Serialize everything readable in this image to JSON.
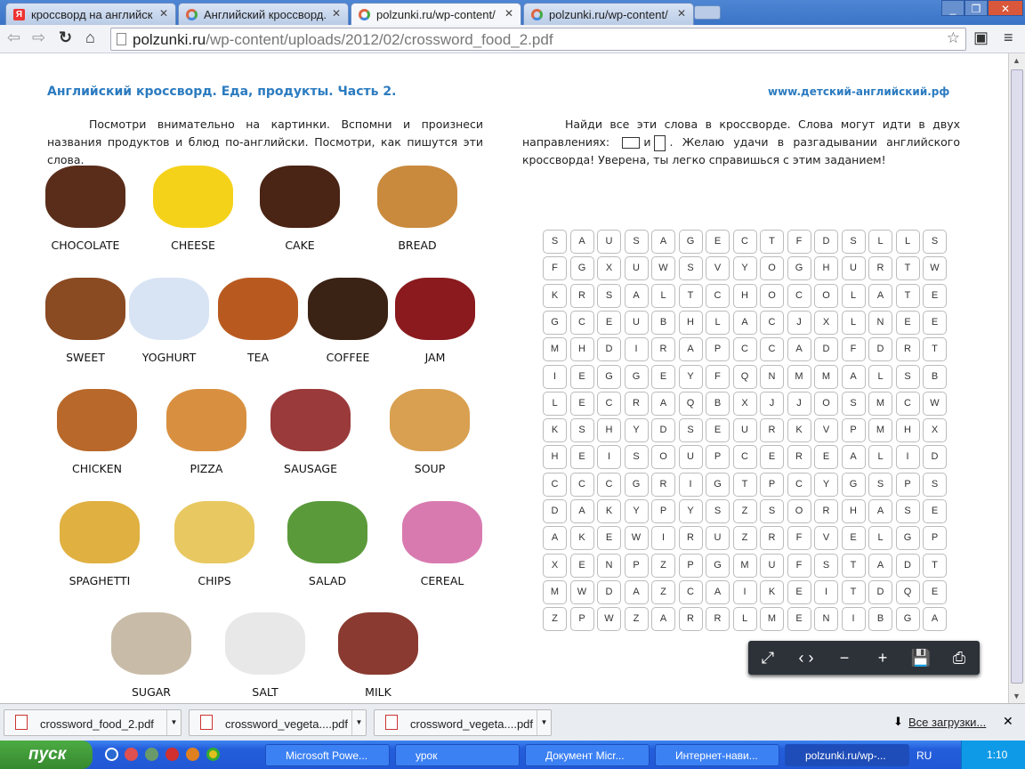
{
  "browser": {
    "tabs": [
      {
        "label": "кроссворд на английск",
        "icon": "yandex-icon"
      },
      {
        "label": "Английский кроссворд.",
        "icon": "site-icon"
      },
      {
        "label": "polzunki.ru/wp-content/",
        "icon": "site-icon",
        "active": true
      },
      {
        "label": "polzunki.ru/wp-content/",
        "icon": "site-icon"
      }
    ],
    "url_host": "polzunki.ru",
    "url_path": "/wp-content/uploads/2012/02/crossword_food_2.pdf"
  },
  "document": {
    "title": "Английский кроссворд. Еда, продукты. Часть 2.",
    "site": "www.детский-английский.рф",
    "left_text": "Посмотри внимательно на картинки. Вспомни и произнеси названия продуктов и блюд по-английски. Посмотри, как пишутся эти слова.",
    "right_text_1": "Найди все эти слова в кроссворде. Слова могут идти в двух направлениях:",
    "right_text_and": "и",
    "right_text_2": ". Желаю удачи в разгадывании английского кроссворда! Уверена, ты легко справишься с этим заданием!",
    "foods": [
      {
        "label": "CHOCOLATE",
        "color": "#5a2d1a"
      },
      {
        "label": "CHEESE",
        "color": "#f5d21a"
      },
      {
        "label": "CAKE",
        "color": "#4a2414"
      },
      {
        "label": "BREAD",
        "color": "#c98a3e"
      },
      {
        "label": "SWEET",
        "color": "#8a4a22"
      },
      {
        "label": "YOGHURT",
        "color": "#d8e4f4"
      },
      {
        "label": "TEA",
        "color": "#b85a20"
      },
      {
        "label": "COFFEE",
        "color": "#3a2214"
      },
      {
        "label": "JAM",
        "color": "#8a1a1e"
      },
      {
        "label": "CHICKEN",
        "color": "#b8682a"
      },
      {
        "label": "PIZZA",
        "color": "#d89040"
      },
      {
        "label": "SAUSAGE",
        "color": "#9a3a3a"
      },
      {
        "label": "SOUP",
        "color": "#d8a050"
      },
      {
        "label": "SPAGHETTI",
        "color": "#e0b040"
      },
      {
        "label": "CHIPS",
        "color": "#e8c860"
      },
      {
        "label": "SALAD",
        "color": "#5a9a3a"
      },
      {
        "label": "CEREAL",
        "color": "#d87ab0"
      },
      {
        "label": "SUGAR",
        "color": "#c8bca8"
      },
      {
        "label": "SALT",
        "color": "#e8e8e8"
      },
      {
        "label": "MILK",
        "color": "#8a3a30"
      }
    ],
    "grid": [
      "SAUSAGECTFDSLLS",
      "FGXUWSVYOGHURTW",
      "KRSALTCHOCOLATE",
      "GCEUBHLACJXLNEE",
      "MHDIRAPCCADFDRT",
      "IEGGEYFQNMMALSB",
      "LECRAQBXJJOSMCW",
      "KSHYDSEURKVPMHX",
      "HEISOUPCEREALID",
      "CCCGRIGTPCYGSPS",
      "DAKYPYSZSORHASE",
      "AKEWIRUZRFVELGP",
      "XENPZPGMUFSTADT",
      "MWDAZCAIKEITDQE",
      "ZPWZARRLMENIBGA"
    ]
  },
  "pdf_toolbar": [
    {
      "name": "fit-page-button",
      "icon": "fit-page-icon",
      "glyph": "⤢"
    },
    {
      "name": "fit-width-button",
      "icon": "fit-width-icon",
      "glyph": "‹ ›"
    },
    {
      "name": "zoom-out-button",
      "icon": "zoom-out-icon",
      "glyph": "−"
    },
    {
      "name": "zoom-in-button",
      "icon": "zoom-in-icon",
      "glyph": "+"
    },
    {
      "name": "save-button",
      "icon": "save-icon",
      "glyph": "💾"
    },
    {
      "name": "print-button",
      "icon": "print-icon",
      "glyph": "⎙"
    }
  ],
  "downloads": {
    "items": [
      "crossword_food_2.pdf",
      "crossword_vegeta....pdf",
      "crossword_vegeta....pdf"
    ],
    "all_label": "Все загрузки..."
  },
  "taskbar": {
    "start": "пуск",
    "tasks": [
      "Microsoft Powe...",
      "урок",
      "Документ Micr...",
      "Интернет-нави...",
      "polzunki.ru/wp-..."
    ],
    "lang": "RU",
    "clock": "1:10"
  }
}
